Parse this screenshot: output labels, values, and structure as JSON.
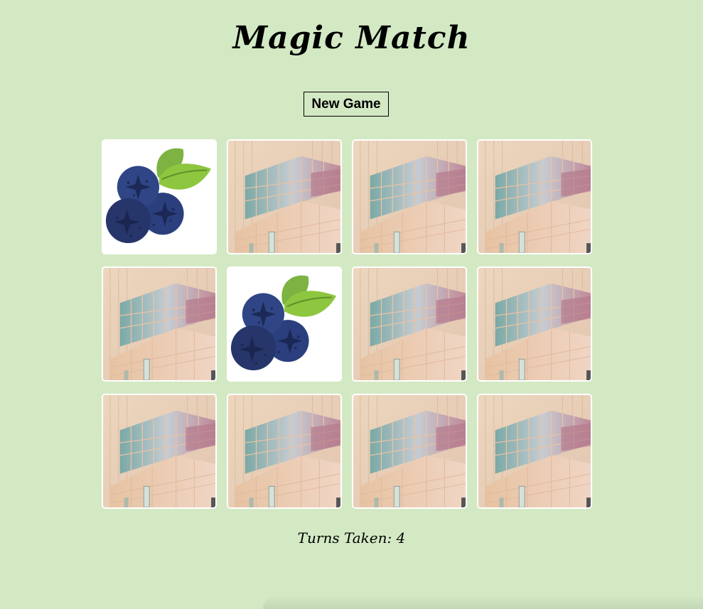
{
  "game": {
    "title": "Magic Match",
    "new_game_label": "New Game",
    "turns_label": "Turns Taken:",
    "turns_value": "4"
  },
  "colors": {
    "background": "#d3e9c4",
    "card_border": "#ffffff",
    "berry_blue": "#2b3f7e",
    "leaf_green": "#7cb342"
  },
  "cards": [
    {
      "state": "face-up",
      "icon": "blueberry-icon"
    },
    {
      "state": "face-down",
      "icon": "card-back-building"
    },
    {
      "state": "face-down",
      "icon": "card-back-building"
    },
    {
      "state": "face-down",
      "icon": "card-back-building"
    },
    {
      "state": "face-down",
      "icon": "card-back-building"
    },
    {
      "state": "face-up",
      "icon": "blueberry-icon"
    },
    {
      "state": "face-down",
      "icon": "card-back-building"
    },
    {
      "state": "face-down",
      "icon": "card-back-building"
    },
    {
      "state": "face-down",
      "icon": "card-back-building"
    },
    {
      "state": "face-down",
      "icon": "card-back-building"
    },
    {
      "state": "face-down",
      "icon": "card-back-building"
    },
    {
      "state": "face-down",
      "icon": "card-back-building"
    }
  ]
}
